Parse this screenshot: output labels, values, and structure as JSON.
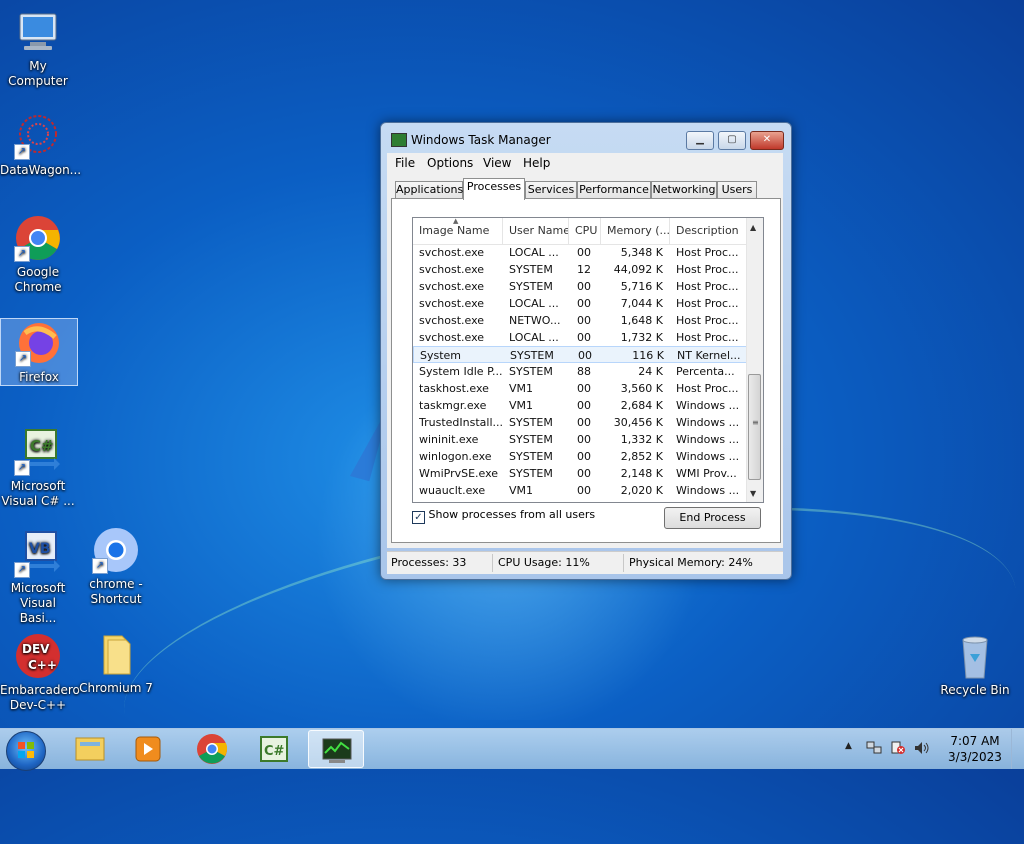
{
  "desktop": {
    "icons": [
      {
        "label": "My Computer"
      },
      {
        "label": "DataWagon..."
      },
      {
        "label": "Google Chrome"
      },
      {
        "label": "Firefox"
      },
      {
        "label": "Microsoft Visual C# ..."
      },
      {
        "label": "Microsoft Visual Basi..."
      },
      {
        "label": "chrome - Shortcut"
      },
      {
        "label": "Embarcadero Dev-C++"
      },
      {
        "label": "Chromium 7"
      },
      {
        "label": "Recycle Bin"
      }
    ]
  },
  "window": {
    "title": "Windows Task Manager",
    "menu": [
      "File",
      "Options",
      "View",
      "Help"
    ],
    "tabs": [
      "Applications",
      "Processes",
      "Services",
      "Performance",
      "Networking",
      "Users"
    ],
    "active_tab": "Processes",
    "columns": [
      "Image Name",
      "User Name",
      "CPU",
      "Memory (...",
      "Description"
    ],
    "rows": [
      {
        "image": "svchost.exe",
        "user": "LOCAL ...",
        "cpu": "00",
        "mem": "5,348 K",
        "desc": "Host Proc..."
      },
      {
        "image": "svchost.exe",
        "user": "SYSTEM",
        "cpu": "12",
        "mem": "44,092 K",
        "desc": "Host Proc..."
      },
      {
        "image": "svchost.exe",
        "user": "SYSTEM",
        "cpu": "00",
        "mem": "5,716 K",
        "desc": "Host Proc..."
      },
      {
        "image": "svchost.exe",
        "user": "LOCAL ...",
        "cpu": "00",
        "mem": "7,044 K",
        "desc": "Host Proc..."
      },
      {
        "image": "svchost.exe",
        "user": "NETWO...",
        "cpu": "00",
        "mem": "1,648 K",
        "desc": "Host Proc..."
      },
      {
        "image": "svchost.exe",
        "user": "LOCAL ...",
        "cpu": "00",
        "mem": "1,732 K",
        "desc": "Host Proc..."
      },
      {
        "image": "System",
        "user": "SYSTEM",
        "cpu": "00",
        "mem": "116 K",
        "desc": "NT Kernel..."
      },
      {
        "image": "System Idle P...",
        "user": "SYSTEM",
        "cpu": "88",
        "mem": "24 K",
        "desc": "Percenta..."
      },
      {
        "image": "taskhost.exe",
        "user": "VM1",
        "cpu": "00",
        "mem": "3,560 K",
        "desc": "Host Proc..."
      },
      {
        "image": "taskmgr.exe",
        "user": "VM1",
        "cpu": "00",
        "mem": "2,684 K",
        "desc": "Windows ..."
      },
      {
        "image": "TrustedInstall...",
        "user": "SYSTEM",
        "cpu": "00",
        "mem": "30,456 K",
        "desc": "Windows ..."
      },
      {
        "image": "wininit.exe",
        "user": "SYSTEM",
        "cpu": "00",
        "mem": "1,332 K",
        "desc": "Windows ..."
      },
      {
        "image": "winlogon.exe",
        "user": "SYSTEM",
        "cpu": "00",
        "mem": "2,852 K",
        "desc": "Windows ..."
      },
      {
        "image": "WmiPrvSE.exe",
        "user": "SYSTEM",
        "cpu": "00",
        "mem": "2,148 K",
        "desc": "WMI Prov..."
      },
      {
        "image": "wuauclt.exe",
        "user": "VM1",
        "cpu": "00",
        "mem": "2,020 K",
        "desc": "Windows ..."
      }
    ],
    "selected_row": 6,
    "show_all_label": "Show processes from all users",
    "show_all_checked": true,
    "end_process_label": "End Process",
    "status": {
      "processes": "Processes: 33",
      "cpu": "CPU Usage: 11%",
      "memory": "Physical Memory: 24%"
    }
  },
  "taskbar": {
    "clock_time": "7:07 AM",
    "clock_date": "3/3/2023"
  }
}
